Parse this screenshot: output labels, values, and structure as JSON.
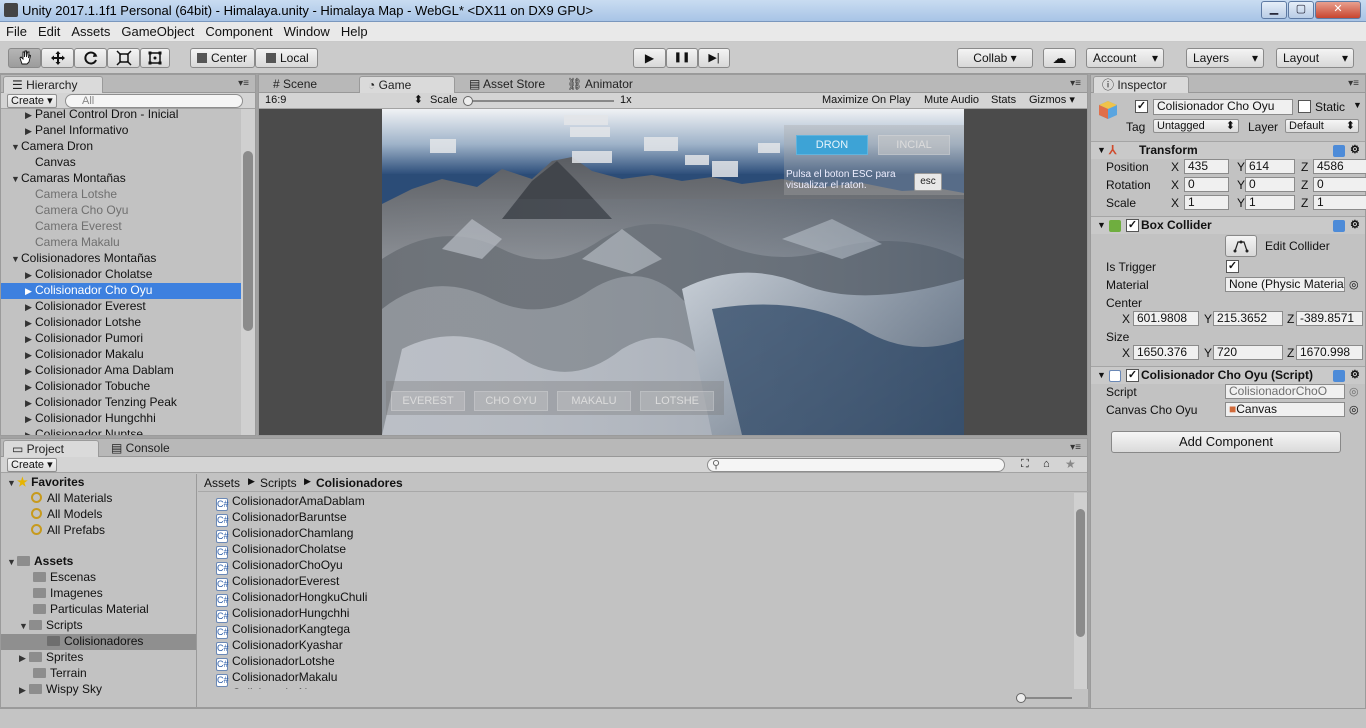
{
  "window": {
    "title": "Unity 2017.1.1f1 Personal (64bit) - Himalaya.unity - Himalaya Map - WebGL* <DX11 on DX9 GPU>",
    "min": "▁",
    "max": "▢",
    "close": "✕"
  },
  "menu": [
    "File",
    "Edit",
    "Assets",
    "GameObject",
    "Component",
    "Window",
    "Help"
  ],
  "toolbar": {
    "tools": [
      "hand-icon",
      "move-icon",
      "rotate-icon",
      "scale-icon",
      "rect-icon"
    ],
    "pivot": "Center",
    "space": "Local",
    "play": "▶",
    "pause": "❚❚",
    "step": "▶|",
    "collab": "Collab",
    "account": "Account",
    "layers": "Layers",
    "layout": "Layout"
  },
  "hierarchy": {
    "tab": "Hierarchy",
    "create": "Create",
    "search_placeholder": "All",
    "rows": [
      {
        "label": "Panel Control Dron - Inicial"
      },
      {
        "label": "Panel Informativo"
      },
      {
        "label": "Camera Dron"
      },
      {
        "label": "Canvas"
      },
      {
        "label": "Camaras Montañas"
      },
      {
        "label": "Camera Lotshe"
      },
      {
        "label": "Camera Cho Oyu"
      },
      {
        "label": "Camera Everest"
      },
      {
        "label": "Camera Makalu"
      },
      {
        "label": "Colisionadores Montañas"
      },
      {
        "label": "Colisionador Cholatse"
      },
      {
        "label": "Colisionador Cho Oyu"
      },
      {
        "label": "Colisionador Everest"
      },
      {
        "label": "Colisionador Lotshe"
      },
      {
        "label": "Colisionador Pumori"
      },
      {
        "label": "Colisionador Makalu"
      },
      {
        "label": "Colisionador Ama Dablam"
      },
      {
        "label": "Colisionador Tobuche"
      },
      {
        "label": "Colisionador Tenzing Peak"
      },
      {
        "label": "Colisionador Hungchhi"
      },
      {
        "label": "Colisionador Nuptse"
      }
    ]
  },
  "center_tabs": {
    "scene": "Scene",
    "game": "Game",
    "asset_store": "Asset Store",
    "animator": "Animator"
  },
  "game_bar": {
    "aspect": "16:9",
    "scale_label": "Scale",
    "scale_value": "1x",
    "maximize": "Maximize On Play",
    "mute": "Mute Audio",
    "stats": "Stats",
    "gizmos": "Gizmos"
  },
  "game_view": {
    "buttons_top": [
      "DRON",
      "INCIAL"
    ],
    "esc_hint": "Pulsa el boton ESC para visualizar el raton.",
    "esc_btn": "esc",
    "buttons_bottom": [
      "EVEREST",
      "CHO OYU",
      "MAKALU",
      "LOTSHE"
    ]
  },
  "inspector": {
    "tab": "Inspector",
    "name": "Colisionador Cho Oyu",
    "static": "Static",
    "tag_label": "Tag",
    "tag": "Untagged",
    "layer_label": "Layer",
    "layer": "Default",
    "transform": {
      "title": "Transform",
      "position_label": "Position",
      "rotation_label": "Rotation",
      "scale_label": "Scale",
      "position": [
        "435",
        "614",
        "4586"
      ],
      "rotation": [
        "0",
        "0",
        "0"
      ],
      "scale": [
        "1",
        "1",
        "1"
      ]
    },
    "box_collider": {
      "title": "Box Collider",
      "edit": "Edit Collider",
      "is_trigger_label": "Is Trigger",
      "material_label": "Material",
      "material": "None (Physic Materia",
      "center_label": "Center",
      "center": [
        "601.9808",
        "215.3652",
        "-389.8571"
      ],
      "size_label": "Size",
      "size": [
        "1650.376",
        "720",
        "1670.998"
      ]
    },
    "script_comp": {
      "title": "Colisionador Cho Oyu (Script)",
      "script_label": "Script",
      "script": "ColisionadorChoO",
      "canvas_label": "Canvas Cho Oyu",
      "canvas": "Canvas"
    },
    "add_component": "Add Component",
    "axes": [
      "X",
      "Y",
      "Z"
    ]
  },
  "project": {
    "tab": "Project",
    "console_tab": "Console",
    "create": "Create",
    "favorites_label": "Favorites",
    "favorites": [
      "All Materials",
      "All Models",
      "All Prefabs"
    ],
    "assets_label": "Assets",
    "folders": [
      "Escenas",
      "Imagenes",
      "Particulas Material",
      "Scripts",
      "Colisionadores",
      "Sprites",
      "Terrain",
      "Wispy Sky"
    ],
    "breadcrumb": [
      "Assets",
      "Scripts",
      "Colisionadores"
    ],
    "files": [
      "ColisionadorAmaDablam",
      "ColisionadorBaruntse",
      "ColisionadorChamlang",
      "ColisionadorCholatse",
      "ColisionadorChoOyu",
      "ColisionadorEverest",
      "ColisionadorHongkuChuli",
      "ColisionadorHungchhi",
      "ColisionadorKangtega",
      "ColisionadorKyashar",
      "ColisionadorLotshe",
      "ColisionadorMakalu",
      "ColisionadorNuptse"
    ]
  },
  "colors": {
    "selection": "#3d80df",
    "panel": "#c2c2c2",
    "sky": "#2e4f7b",
    "cyan_btn": "#3da3d6"
  }
}
